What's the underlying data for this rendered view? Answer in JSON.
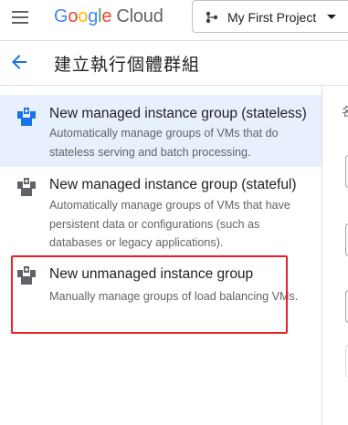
{
  "header": {
    "logo": {
      "google_letters": [
        {
          "ch": "G",
          "color": "#4285F4"
        },
        {
          "ch": "o",
          "color": "#EA4335"
        },
        {
          "ch": "o",
          "color": "#FBBC05"
        },
        {
          "ch": "g",
          "color": "#4285F4"
        },
        {
          "ch": "l",
          "color": "#34A853"
        },
        {
          "ch": "e",
          "color": "#EA4335"
        }
      ],
      "product": "Cloud"
    },
    "menu_icon": "hamburger-menu-icon",
    "project_selector": {
      "label": "My First Project",
      "icon": "project-hierarchy-icon"
    }
  },
  "page": {
    "title": "建立執行個體群組",
    "back_icon": "arrow-back-icon"
  },
  "options": [
    {
      "title": "New managed instance group (stateless)",
      "description": "Automatically manage groups of VMs that do stateless serving and batch processing.",
      "icon": "instance-group-icon",
      "selected": true,
      "icon_color": "#1a73e8"
    },
    {
      "title": "New managed instance group (stateful)",
      "description": "Automatically manage groups of VMs that have persistent data or configurations (such as databases or legacy applications).",
      "icon": "instance-group-icon",
      "selected": false,
      "icon_color": "#5f6368"
    },
    {
      "title": "New unmanaged instance group",
      "description": "Manually manage groups of load balancing VMs.",
      "icon": "instance-group-icon",
      "selected": false,
      "icon_color": "#5f6368"
    }
  ],
  "right_panel": {
    "heading_char": "名"
  },
  "colors": {
    "selected_bg": "#e8f0fe",
    "accent": "#1a73e8",
    "highlight_box": "#e8202a",
    "divider": "#dadce0"
  }
}
